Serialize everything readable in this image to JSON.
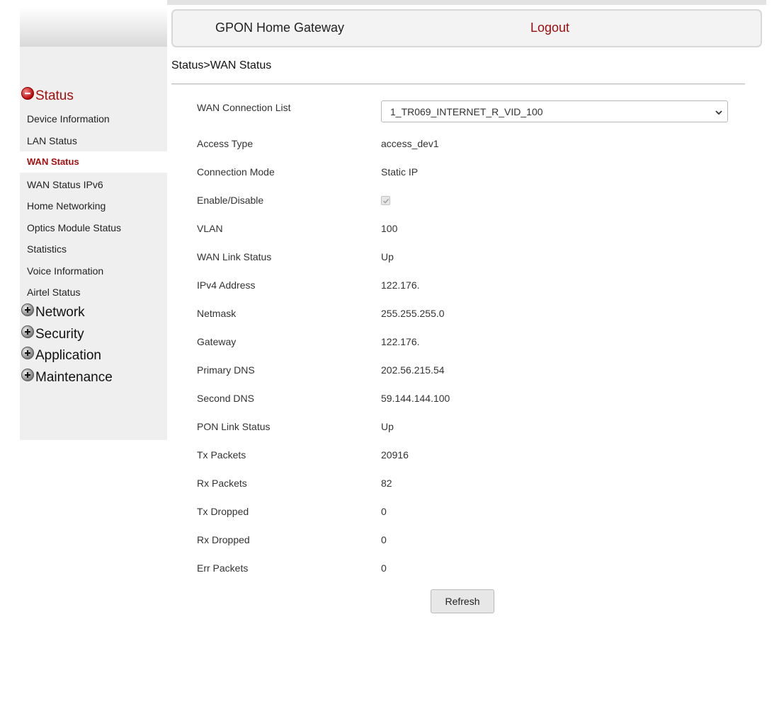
{
  "header": {
    "title": "GPON Home Gateway",
    "logout": "Logout"
  },
  "sidebar": {
    "status": {
      "label": "Status",
      "items": [
        "Device Information",
        "LAN Status",
        "WAN Status",
        "WAN Status IPv6",
        "Home Networking",
        "Optics Module Status",
        "Statistics",
        "Voice Information",
        "Airtel Status"
      ],
      "active": "WAN Status"
    },
    "network": "Network",
    "security": "Security",
    "application": "Application",
    "maintenance": "Maintenance"
  },
  "breadcrumb": "Status>WAN Status",
  "wan_connection": {
    "label": "WAN Connection List",
    "selected": "1_TR069_INTERNET_R_VID_100"
  },
  "fields": {
    "access_type": {
      "label": "Access Type",
      "value": "access_dev1"
    },
    "connection_mode": {
      "label": "Connection Mode",
      "value": "Static IP"
    },
    "enable": {
      "label": "Enable/Disable",
      "checked": true
    },
    "vlan": {
      "label": "VLAN",
      "value": "100"
    },
    "wan_link_status": {
      "label": "WAN Link Status",
      "value": "Up"
    },
    "ipv4_address": {
      "label": "IPv4 Address",
      "value": "122.176."
    },
    "netmask": {
      "label": "Netmask",
      "value": "255.255.255.0"
    },
    "gateway": {
      "label": "Gateway",
      "value": "122.176."
    },
    "primary_dns": {
      "label": "Primary DNS",
      "value": "202.56.215.54"
    },
    "second_dns": {
      "label": "Second DNS",
      "value": "59.144.144.100"
    },
    "pon_link_status": {
      "label": "PON Link Status",
      "value": "Up"
    },
    "tx_packets": {
      "label": "Tx Packets",
      "value": "20916"
    },
    "rx_packets": {
      "label": "Rx Packets",
      "value": "82"
    },
    "tx_dropped": {
      "label": "Tx Dropped",
      "value": "0"
    },
    "rx_dropped": {
      "label": "Rx Dropped",
      "value": "0"
    },
    "err_packets": {
      "label": "Err Packets",
      "value": "0"
    }
  },
  "refresh_button": "Refresh",
  "colors": {
    "accent": "#a50f0f",
    "sidebar_bg": "#efefef"
  },
  "icons": {
    "expanded": "minus-circle-icon",
    "collapsed": "plus-circle-icon",
    "dropdown": "chevron-down-icon"
  }
}
